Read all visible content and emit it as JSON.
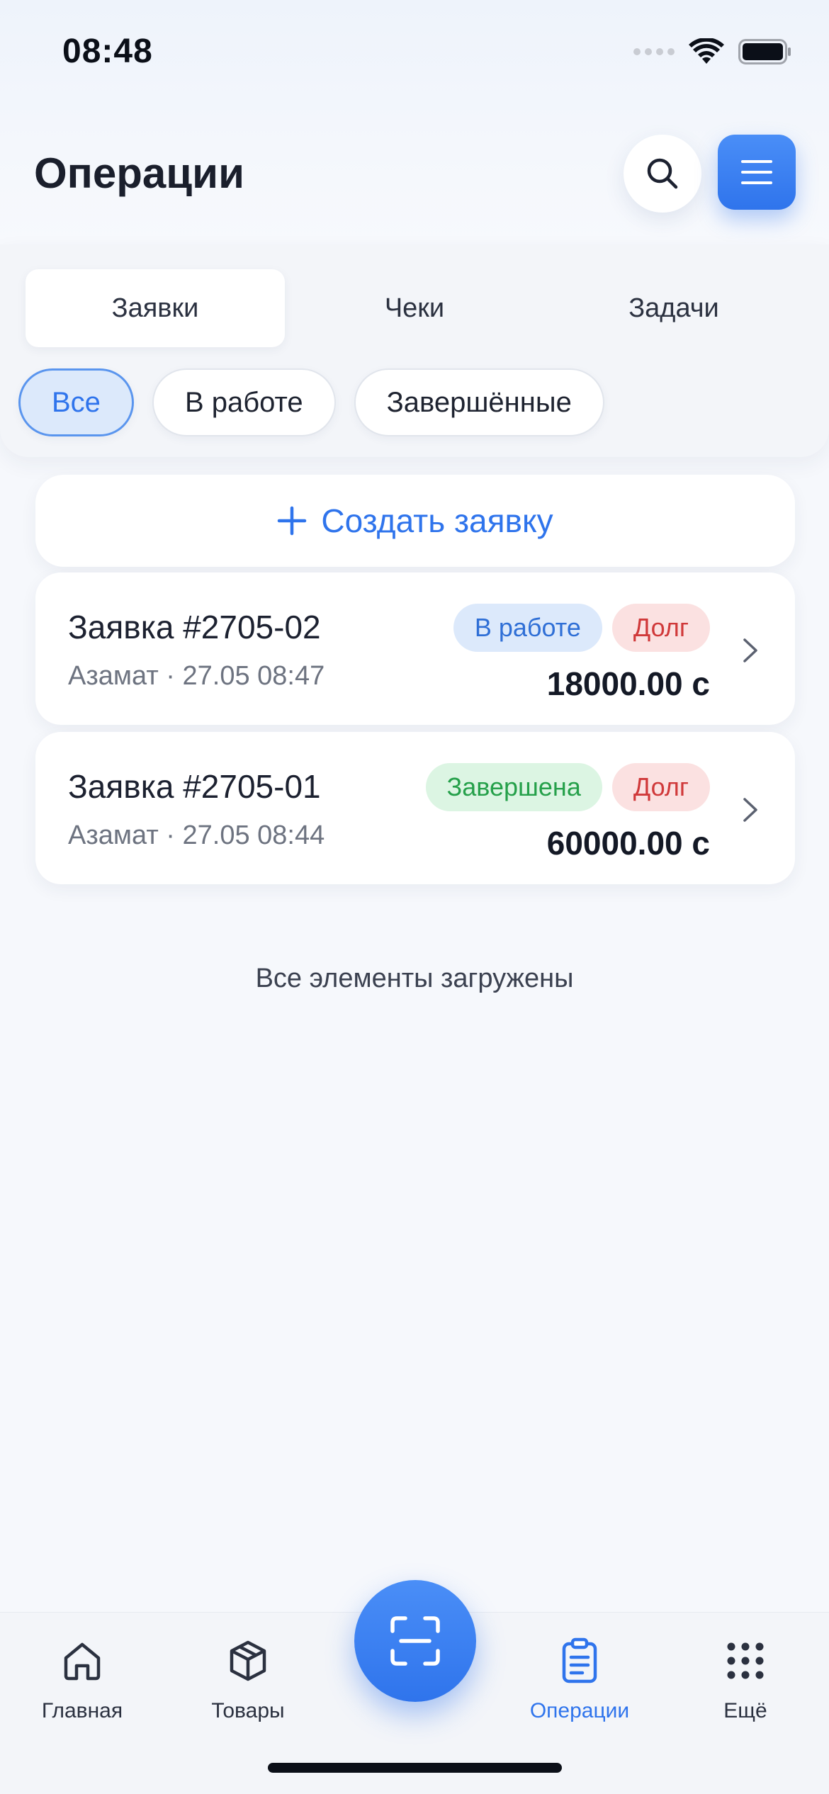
{
  "status_bar": {
    "time": "08:48"
  },
  "header": {
    "title": "Операции"
  },
  "tabs": [
    {
      "label": "Заявки",
      "active": true
    },
    {
      "label": "Чеки",
      "active": false
    },
    {
      "label": "Задачи",
      "active": false
    }
  ],
  "filters": [
    {
      "label": "Все",
      "active": true
    },
    {
      "label": "В работе",
      "active": false
    },
    {
      "label": "Завершённые",
      "active": false
    }
  ],
  "create": {
    "label": "Создать заявку"
  },
  "requests": [
    {
      "title": "Заявка #2705-02",
      "author": "Азамат",
      "separator": "·",
      "datetime": "27.05 08:47",
      "status": "В работе",
      "payment": "Долг",
      "amount": "18000.00 с"
    },
    {
      "title": "Заявка #2705-01",
      "author": "Азамат",
      "separator": "·",
      "datetime": "27.05 08:44",
      "status": "Завершена",
      "payment": "Долг",
      "amount": "60000.00 с"
    }
  ],
  "list_footer": "Все элементы загружены",
  "bottom_nav": {
    "home": "Главная",
    "products": "Товары",
    "operations": "Операции",
    "more": "Ещё"
  },
  "colors": {
    "accent": "#2f74ec",
    "badge_in_work_bg": "#dce9fb",
    "badge_in_work_text": "#2f6fd6",
    "badge_done_bg": "#dcf5e3",
    "badge_done_text": "#25a04a",
    "badge_debt_bg": "#fbe1e1",
    "badge_debt_text": "#d0393a"
  },
  "icons": {
    "search": "search-icon",
    "menu": "menu-icon",
    "plus": "plus-icon",
    "chevron": "chevron-right-icon",
    "scan": "scan-icon",
    "home": "home-icon",
    "box": "box-icon",
    "clipboard": "clipboard-icon",
    "grid": "grid-dots-icon"
  }
}
